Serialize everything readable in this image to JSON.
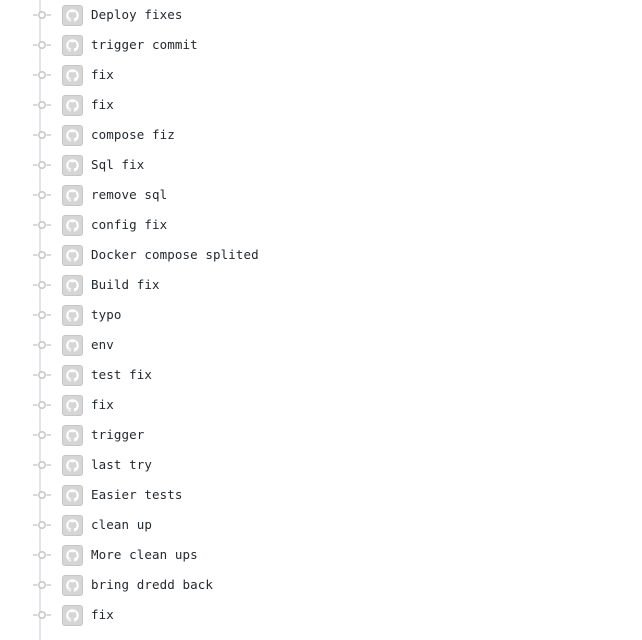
{
  "commits": [
    {
      "message": "Deploy fixes",
      "avatar_icon": "github-octocat-icon"
    },
    {
      "message": "trigger commit",
      "avatar_icon": "github-octocat-icon"
    },
    {
      "message": "fix",
      "avatar_icon": "github-octocat-icon"
    },
    {
      "message": "fix",
      "avatar_icon": "github-octocat-icon"
    },
    {
      "message": "compose fiz",
      "avatar_icon": "github-octocat-icon"
    },
    {
      "message": "Sql fix",
      "avatar_icon": "github-octocat-icon"
    },
    {
      "message": "remove sql",
      "avatar_icon": "github-octocat-icon"
    },
    {
      "message": "config fix",
      "avatar_icon": "github-octocat-icon"
    },
    {
      "message": "Docker compose splited",
      "avatar_icon": "github-octocat-icon"
    },
    {
      "message": "Build fix",
      "avatar_icon": "github-octocat-icon"
    },
    {
      "message": "typo",
      "avatar_icon": "github-octocat-icon"
    },
    {
      "message": "env",
      "avatar_icon": "github-octocat-icon"
    },
    {
      "message": "test fix",
      "avatar_icon": "github-octocat-icon"
    },
    {
      "message": "fix",
      "avatar_icon": "github-octocat-icon"
    },
    {
      "message": "trigger",
      "avatar_icon": "github-octocat-icon"
    },
    {
      "message": "last try",
      "avatar_icon": "github-octocat-icon"
    },
    {
      "message": "Easier tests",
      "avatar_icon": "github-octocat-icon"
    },
    {
      "message": "clean up",
      "avatar_icon": "github-octocat-icon"
    },
    {
      "message": "More clean ups",
      "avatar_icon": "github-octocat-icon"
    },
    {
      "message": "bring dredd back",
      "avatar_icon": "github-octocat-icon"
    },
    {
      "message": "fix",
      "avatar_icon": "github-octocat-icon"
    }
  ],
  "colors": {
    "timeline_line": "#e1e4e8",
    "node": "#c8c8c8",
    "avatar_bg": "#d3d3d3",
    "text": "#24292e"
  }
}
